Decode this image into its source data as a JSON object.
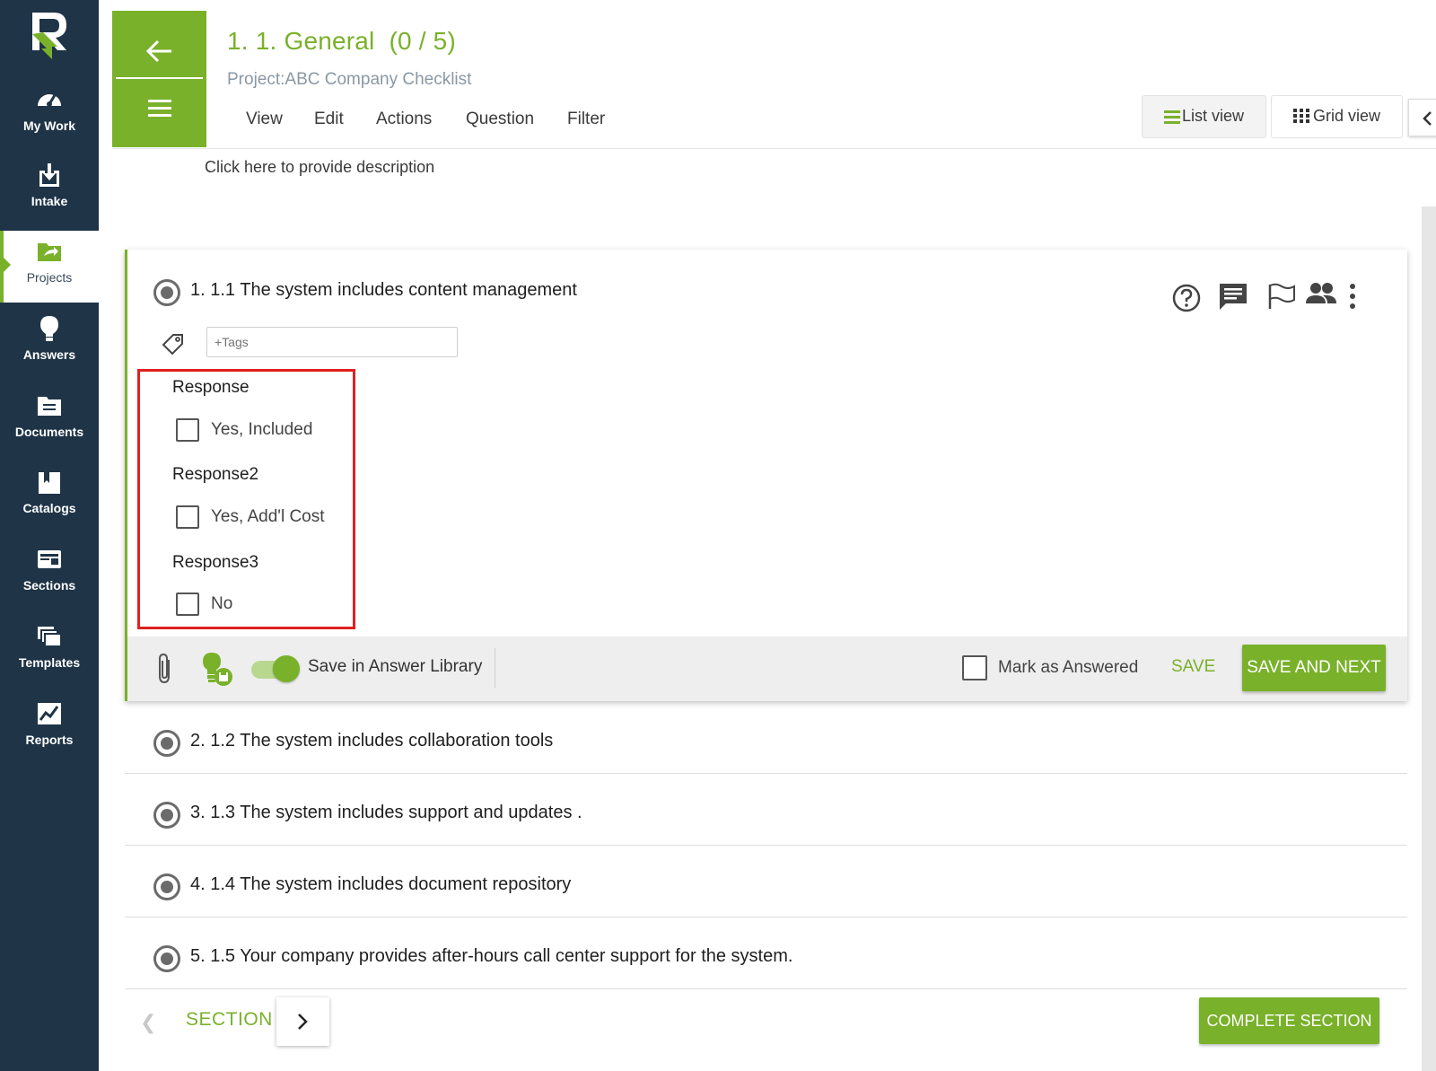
{
  "sidebar": {
    "items": [
      {
        "label": "My Work",
        "icon": "speedometer-icon"
      },
      {
        "label": "Intake",
        "icon": "download-icon"
      },
      {
        "label": "Projects",
        "icon": "folder-arrow-icon",
        "active": true
      },
      {
        "label": "Answers",
        "icon": "lightbulb-icon"
      },
      {
        "label": "Documents",
        "icon": "folder-document-icon"
      },
      {
        "label": "Catalogs",
        "icon": "book-icon"
      },
      {
        "label": "Sections",
        "icon": "section-card-icon"
      },
      {
        "label": "Templates",
        "icon": "stacked-windows-icon"
      },
      {
        "label": "Reports",
        "icon": "chart-line-icon"
      }
    ]
  },
  "header": {
    "title": "1. 1. General",
    "count": "(0 / 5)",
    "project": "Project:ABC Company Checklist",
    "menu": [
      "View",
      "Edit",
      "Actions",
      "Question",
      "Filter"
    ],
    "list_view": "List view",
    "grid_view": "Grid view",
    "description": "Click here to provide description"
  },
  "active_question": {
    "title": "1. 1.1 The system includes content management",
    "tags_placeholder": "+Tags",
    "responses": [
      {
        "label": "Response",
        "option": "Yes, Included",
        "checked": false
      },
      {
        "label": "Response2",
        "option": "Yes, Add'l Cost",
        "checked": false
      },
      {
        "label": "Response3",
        "option": "No",
        "checked": false
      }
    ],
    "save_library_label": "Save in Answer Library",
    "save_library_on": true,
    "mark_answered_label": "Mark as Answered",
    "save_label": "SAVE",
    "save_next_label": "SAVE AND NEXT"
  },
  "questions": [
    "2. 1.2 The system includes collaboration tools",
    "3. 1.3 The system includes support and updates .",
    "4. 1.4 The system includes document repository",
    "5. 1.5 Your company provides after-hours call center support for the system."
  ],
  "footer": {
    "section_label": "SECTION",
    "complete_label": "COMPLETE SECTION"
  },
  "colors": {
    "accent": "#79b12a",
    "sidebar_bg": "#1f3447",
    "highlight": "#e02020"
  }
}
